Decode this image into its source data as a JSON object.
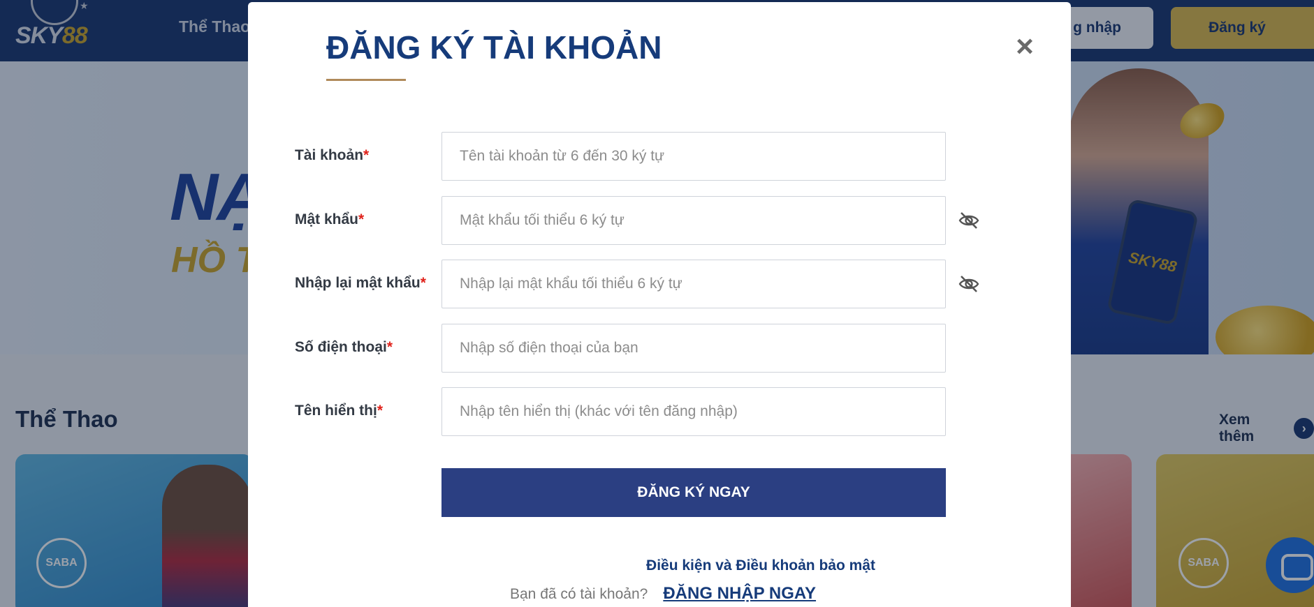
{
  "header": {
    "logo_text": "SKY",
    "logo_number": "88",
    "nav_sports": "Thể Thao",
    "login_label": "g nhập",
    "register_label": "Đăng ký"
  },
  "banner": {
    "headline": "NẠP",
    "subline": "HỒ TR",
    "phone_logo": "SKY88"
  },
  "section": {
    "title": "Thể Thao",
    "see_more": "Xem thêm",
    "saba_text": "SABA"
  },
  "modal": {
    "title": "ĐĂNG KÝ TÀI KHOẢN",
    "close_symbol": "×",
    "required_mark": "*",
    "fields": [
      {
        "label": "Tài khoản",
        "placeholder": "Tên tài khoản từ 6 đến 30 ký tự",
        "type": "text",
        "eye": false
      },
      {
        "label": "Mật khẩu",
        "placeholder": "Mật khẩu tối thiểu 6 ký tự",
        "type": "password",
        "eye": true
      },
      {
        "label": "Nhập lại mật khẩu",
        "placeholder": "Nhập lại mật khẩu tối thiểu 6 ký tự",
        "type": "password",
        "eye": true
      },
      {
        "label": "Số điện thoại",
        "placeholder": "Nhập số điện thoại của bạn",
        "type": "tel",
        "eye": false
      },
      {
        "label": "Tên hiển thị",
        "placeholder": "Nhập tên hiển thị (khác với tên đăng nhập)",
        "type": "text",
        "eye": false
      }
    ],
    "submit_label": "ĐĂNG KÝ NGAY",
    "terms_label": "Điều kiện và Điều khoản bảo mật",
    "have_account_text": "Bạn đã có tài khoản?",
    "login_now_label": "ĐĂNG NHẬP NGAY"
  },
  "colors": {
    "header_bg": "#16336d",
    "title": "#163b7a",
    "submit_bg": "#2b3f82",
    "required": "#e0221b",
    "gold": "#c9a227"
  }
}
